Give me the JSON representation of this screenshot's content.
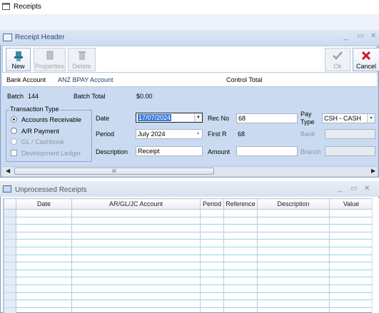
{
  "window": {
    "title": "Receipts"
  },
  "receipt_header": {
    "title": "Receipt Header",
    "toolbar": {
      "new": "New",
      "properties": "Properties",
      "delete": "Delete",
      "ok": "Ok",
      "cancel": "Cancel"
    },
    "bank_account_label": "Bank Account",
    "bank_account_value": "ANZ BPAY Account",
    "control_total_label": "Control Total",
    "batch_label": "Batch",
    "batch_value": "144",
    "batch_total_label": "Batch Total",
    "batch_total_value": "$0.00",
    "transaction_type": {
      "legend": "Transaction Type",
      "options": [
        "Accounts Receivable",
        "A/R Payment",
        "GL / Cashbook"
      ],
      "selected": "Accounts Receivable",
      "development_ledger_label": "Development Ledger",
      "development_ledger_checked": false
    },
    "date_label": "Date",
    "date_value": "17/07/2024",
    "period_label": "Period",
    "period_value": "July 2024",
    "description_label": "Description",
    "description_value": "Receipt",
    "rec_no_label": "Rec No",
    "rec_no_value": "68",
    "first_r_label": "First R",
    "first_r_value": "68",
    "amount_label": "Amount",
    "amount_value": "",
    "pay_type_label_1": "Pay",
    "pay_type_label_2": "Type",
    "pay_type_value": "CSH - CASH",
    "bank_label": "Bank",
    "bank_value": "",
    "branch_label": "Branch",
    "branch_value": "",
    "scroll_thumb": "III"
  },
  "unprocessed": {
    "title": "Unprocessed Receipts",
    "columns": [
      "Date",
      "AR/GL/JC Account",
      "Period",
      "Reference",
      "Description",
      "Value"
    ],
    "row_count": 14
  },
  "colors": {
    "panel": "#cadbf1",
    "accent": "#2d4b73",
    "cancel_x": "#d0181c",
    "ok_check": "#9aa3ad"
  }
}
